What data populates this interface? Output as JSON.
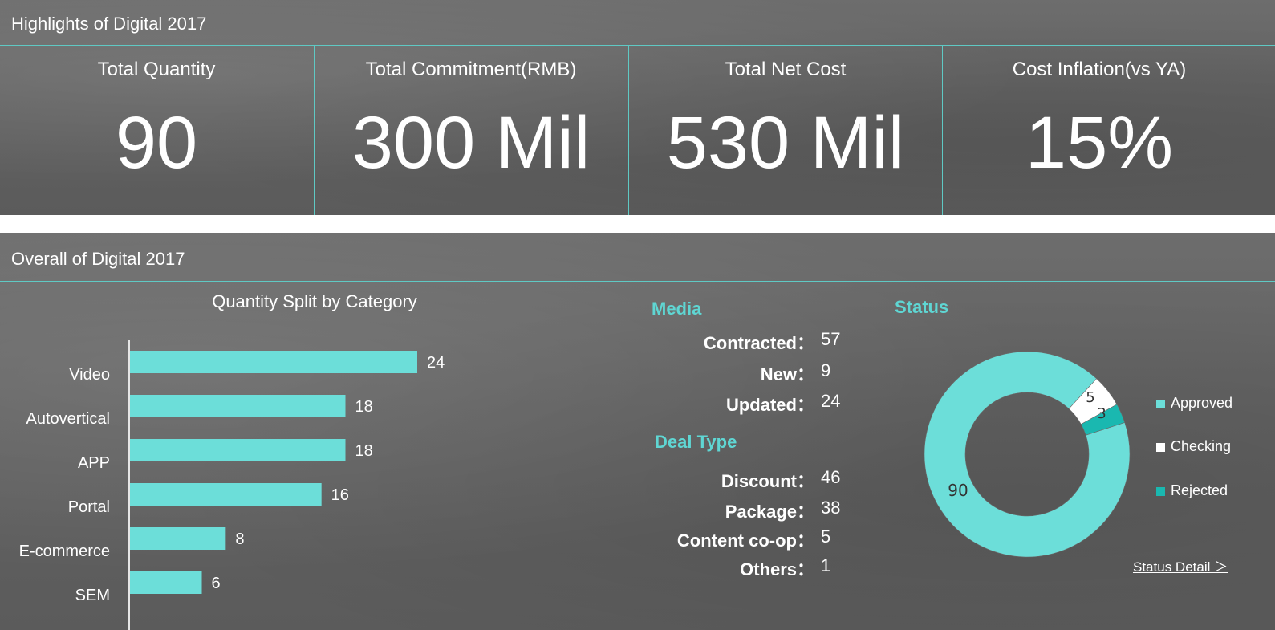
{
  "highlights": {
    "title": "Highlights of Digital 2017",
    "kpis": [
      {
        "label": "Total Quantity",
        "value": "90"
      },
      {
        "label": "Total Commitment(RMB)",
        "value": "300 Mil"
      },
      {
        "label": "Total Net Cost",
        "value": "530 Mil"
      },
      {
        "label": "Cost Inflation(vs YA)",
        "value": "15%"
      }
    ]
  },
  "overall": {
    "title": "Overall of Digital 2017",
    "media": {
      "title": "Media",
      "rows": [
        {
          "label": "Contracted：",
          "value": "57"
        },
        {
          "label": "New：",
          "value": "9"
        },
        {
          "label": "Updated：",
          "value": "24"
        }
      ]
    },
    "deal_type": {
      "title": "Deal Type",
      "rows": [
        {
          "label": "Discount：",
          "value": "46"
        },
        {
          "label": "Package：",
          "value": "38"
        },
        {
          "label": "Content co-op：",
          "value": "5"
        },
        {
          "label": "Others：",
          "value": "1"
        }
      ]
    },
    "status": {
      "title": "Status",
      "detail_link": "Status Detail ＞"
    }
  },
  "colors": {
    "accent": "#6cded9",
    "rejected": "#1ab8b0",
    "checking": "#ffffff",
    "title_text": "#5fd6d3"
  },
  "chart_data": [
    {
      "type": "bar",
      "orientation": "horizontal",
      "title": "Quantity Split by Category",
      "categories": [
        "Video",
        "Autovertical",
        "APP",
        "Portal",
        "E-commerce",
        "SEM"
      ],
      "values": [
        24,
        18,
        18,
        16,
        8,
        6
      ],
      "xlim": [
        0,
        28
      ],
      "grid": false,
      "data_labels": true
    },
    {
      "type": "pie",
      "donut": true,
      "labels": [
        "Approved",
        "Checking",
        "Rejected"
      ],
      "values": [
        90,
        5,
        3
      ],
      "legend": "right"
    }
  ]
}
